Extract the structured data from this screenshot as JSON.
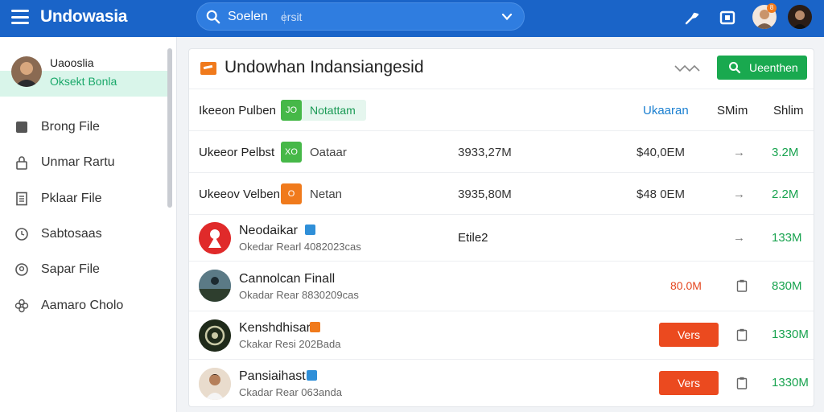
{
  "app": {
    "title": "Undowasia"
  },
  "search": {
    "label": "Soelen",
    "extra": "",
    "placeholder": "ersit"
  },
  "colors": {
    "topbar": "#1a64c8",
    "accent_green": "#19a94f",
    "accent_orange": "#f07a1c",
    "action_red": "#eb4a1f",
    "profile_highlight": "#d9f5ea"
  },
  "toolbar": {
    "icons": [
      "wrench-icon",
      "square-icon",
      "user-avatar",
      "user-avatar-2"
    ],
    "notif_badge": "8"
  },
  "sidebar": {
    "profile": {
      "name": "Uaooslia",
      "sub": "Oksekt Bonla"
    },
    "items": [
      {
        "label": "Brong File",
        "icon": "file-icon"
      },
      {
        "label": "Unmar Rartu",
        "icon": "lock-icon"
      },
      {
        "label": "Pklaar File",
        "icon": "document-icon"
      },
      {
        "label": "Sabtosaas",
        "icon": "clock-icon"
      },
      {
        "label": "Sapar File",
        "icon": "location-icon"
      },
      {
        "label": "Aamaro Cholo",
        "icon": "flower-icon"
      }
    ]
  },
  "main": {
    "title": "Undowhan Indansiangesid",
    "button_label": "Ueenthen",
    "header": {
      "col1": "Ikeeon Pulben",
      "tag_square": "JO",
      "tag_label": "Notattam",
      "col3": "Ukaaran",
      "col4": "SMim",
      "col5": "Shlim"
    },
    "simple_rows": [
      {
        "name": "Ukeeor Pelbst",
        "badge": "XO",
        "badge_color": "#46b848",
        "type": "Oataar",
        "volume": "3933,27M",
        "price": "$40,0EM",
        "arrow": "→",
        "total": "3.2M"
      },
      {
        "name": "Ukeeov Velben",
        "badge": "O",
        "badge_color": "#f07a1c",
        "type": "Netan",
        "volume": "3935,80M",
        "price": "$48 0EM",
        "arrow": "→",
        "total": "2.2M"
      }
    ],
    "profile_rows": [
      {
        "title": "Neodaikar",
        "sub": "Okedar Rearl 4082023cas",
        "flag_color": "#2f8fd8",
        "mid": "Etile2",
        "red": "",
        "action": "",
        "arrow": "→",
        "total": "133M"
      },
      {
        "title": "Cannolcan Finall",
        "sub": "Okadar Rear 8830209cas",
        "flag_color": "",
        "mid": "",
        "red": "80.0M",
        "action": "",
        "arrow": "",
        "total": "830M"
      },
      {
        "title": "Kenshdhisar",
        "sub": "Ckakar Resi 202Bada",
        "flag_color": "#f07a1c",
        "mid": "",
        "red": "",
        "action": "Vers",
        "arrow": "",
        "total": "1330M"
      },
      {
        "title": "Pansiaihast",
        "sub": "Ckadar Rear 063anda",
        "flag_color": "#2f8fd8",
        "mid": "",
        "red": "",
        "action": "Vers",
        "arrow": "",
        "total": "1330M"
      }
    ]
  }
}
